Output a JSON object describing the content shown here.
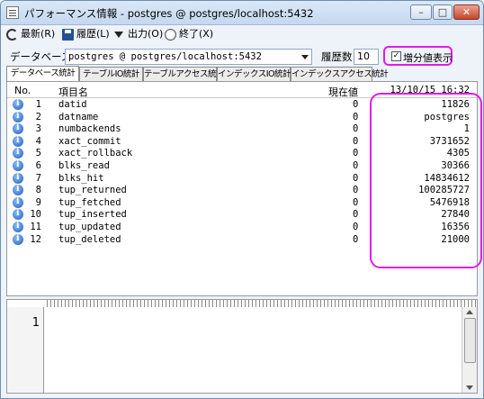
{
  "window": {
    "title": "パフォーマンス情報 - postgres @ postgres/localhost:5432",
    "controls": {
      "minimize": "–",
      "maximize": "□",
      "close": "✕"
    }
  },
  "toolbar": {
    "refresh": "最新(R)",
    "history": "履歴(L)",
    "output": "出力(O)",
    "exit": "終了(X)"
  },
  "database": {
    "label": "データベース",
    "selected": "postgres @ postgres/localhost:5432",
    "history_label": "履歴数",
    "history_value": "10",
    "diff_checkbox_label": "増分値表示",
    "diff_checked": true
  },
  "tabs": [
    {
      "label": "データベース統計"
    },
    {
      "label": "テーブルIO統計"
    },
    {
      "label": "テーブルアクセス統計"
    },
    {
      "label": "インデックスIO統計"
    },
    {
      "label": "インデックスアクセス統計"
    }
  ],
  "table": {
    "headers": {
      "no": "No.",
      "name": "項目名",
      "current": "現在値",
      "timestamp": "13/10/15 16:32"
    },
    "rows": [
      {
        "no": "1",
        "name": "datid",
        "current": "0",
        "value": "11826"
      },
      {
        "no": "2",
        "name": "datname",
        "current": "0",
        "value": "postgres"
      },
      {
        "no": "3",
        "name": "numbackends",
        "current": "0",
        "value": "1"
      },
      {
        "no": "4",
        "name": "xact_commit",
        "current": "0",
        "value": "3731652"
      },
      {
        "no": "5",
        "name": "xact_rollback",
        "current": "0",
        "value": "4305"
      },
      {
        "no": "6",
        "name": "blks_read",
        "current": "0",
        "value": "30366"
      },
      {
        "no": "7",
        "name": "blks_hit",
        "current": "0",
        "value": "14834612"
      },
      {
        "no": "8",
        "name": "tup_returned",
        "current": "0",
        "value": "100285727"
      },
      {
        "no": "9",
        "name": "tup_fetched",
        "current": "0",
        "value": "5476918"
      },
      {
        "no": "10",
        "name": "tup_inserted",
        "current": "0",
        "value": "27840"
      },
      {
        "no": "11",
        "name": "tup_updated",
        "current": "0",
        "value": "16356"
      },
      {
        "no": "12",
        "name": "tup_deleted",
        "current": "0",
        "value": "21000"
      }
    ]
  },
  "editor": {
    "line_number": "1"
  },
  "colors": {
    "highlight": "#e21be8",
    "info_icon": "#1d59b8"
  }
}
